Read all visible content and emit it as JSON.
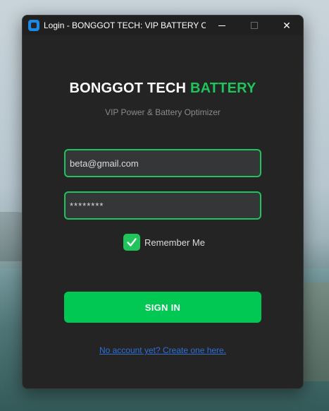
{
  "window": {
    "title": "Login - BONGGOT TECH: VIP BATTERY OP...",
    "controls": {
      "minimize_icon": "minimize-icon",
      "maximize_icon": "maximize-icon",
      "close_icon": "close-icon",
      "close_glyph": "✕"
    }
  },
  "brand": {
    "title_main": "BONGGOT TECH",
    "title_accent": "BATTERY",
    "subtitle": "VIP Power & Battery Optimizer",
    "accent_color": "#1fc45a"
  },
  "form": {
    "email_value": "beta@gmail.com",
    "password_value": "********",
    "remember_label": "Remember Me",
    "remember_checked": true,
    "signin_label": "SIGN IN",
    "create_account_link": "No account yet? Create one here."
  },
  "colors": {
    "window_bg": "#242424",
    "field_bg": "#343638",
    "button_bg": "#00c853",
    "link": "#2f6fd6"
  }
}
